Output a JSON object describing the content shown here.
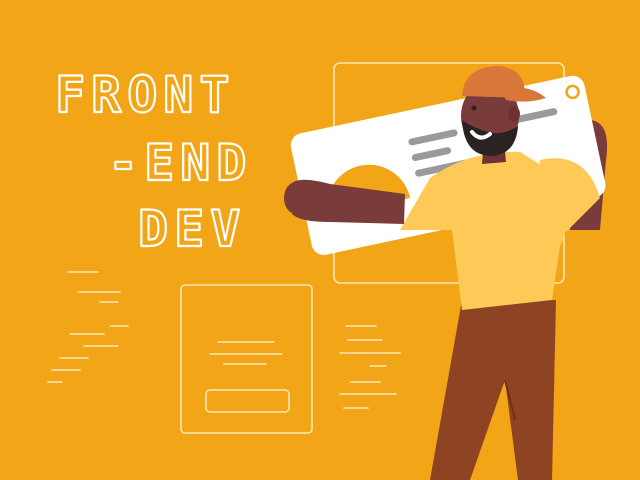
{
  "title_lines": [
    "FRONT",
    "-END",
    "DEV"
  ],
  "colors": {
    "background": "#F2A516",
    "outline": "#FFE7B3",
    "shirt": "#FFC957",
    "pants": "#8E4322",
    "skin": "#7A3B3B",
    "cap": "#D9773A",
    "card": "#FFFFFF"
  },
  "icons": [
    "person-illustration",
    "browser-card-icon",
    "wireframe-form-icon"
  ]
}
